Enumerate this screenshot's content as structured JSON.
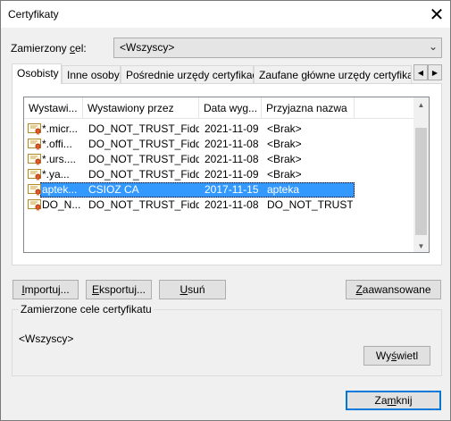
{
  "window": {
    "title": "Certyfikaty",
    "close_symbol": "✕"
  },
  "purpose": {
    "label_pre": "Zamierzony ",
    "label_ul": "c",
    "label_post": "el:",
    "selected": "<Wszyscy>",
    "chevron": "⌄"
  },
  "tabs": [
    {
      "label": "Osobisty"
    },
    {
      "label": "Inne osoby"
    },
    {
      "label": "Pośrednie urzędy certyfikacji"
    },
    {
      "label": "Zaufane główne urzędy certyfikacji"
    }
  ],
  "tab_scroll": {
    "left": "◀",
    "right": "▶"
  },
  "list": {
    "columns": [
      "Wystawi...",
      "Wystawiony przez",
      "Data wyg...",
      "Przyjazna nazwa"
    ],
    "rows": [
      {
        "issued_to": "*.micr...",
        "issued_by": "DO_NOT_TRUST_Fidd...",
        "expires": "2021-11-09",
        "friendly": "<Brak>"
      },
      {
        "issued_to": "*.offi...",
        "issued_by": "DO_NOT_TRUST_Fidd...",
        "expires": "2021-11-08",
        "friendly": "<Brak>"
      },
      {
        "issued_to": "*.urs....",
        "issued_by": "DO_NOT_TRUST_Fidd...",
        "expires": "2021-11-08",
        "friendly": "<Brak>"
      },
      {
        "issued_to": "*.ya...",
        "issued_by": "DO_NOT_TRUST_Fidd...",
        "expires": "2021-11-09",
        "friendly": "<Brak>"
      },
      {
        "issued_to": "aptek...",
        "issued_by": "CSIOZ CA",
        "expires": "2017-11-15",
        "friendly": "apteka",
        "selected": true
      },
      {
        "issued_to": "DO_N...",
        "issued_by": "DO_NOT_TRUST_Fidd...",
        "expires": "2021-11-08",
        "friendly": "DO_NOT_TRUST..."
      }
    ],
    "scroll_up": "▲",
    "scroll_down": "▼"
  },
  "buttons": {
    "import": {
      "ul": "I",
      "rest": "mportuj..."
    },
    "export": {
      "ul": "E",
      "rest": "ksportuj..."
    },
    "remove": {
      "ul": "U",
      "rest": "suń"
    },
    "advanced": {
      "ul": "Z",
      "rest": "aawansowane"
    },
    "view": {
      "pre": "Wy",
      "ul": "ś",
      "rest": "wietl"
    },
    "close": {
      "pre": "Za",
      "ul": "m",
      "rest": "knij"
    }
  },
  "intended_purposes": {
    "title": "Zamierzone cele certyfikatu",
    "value": "<Wszyscy>"
  }
}
